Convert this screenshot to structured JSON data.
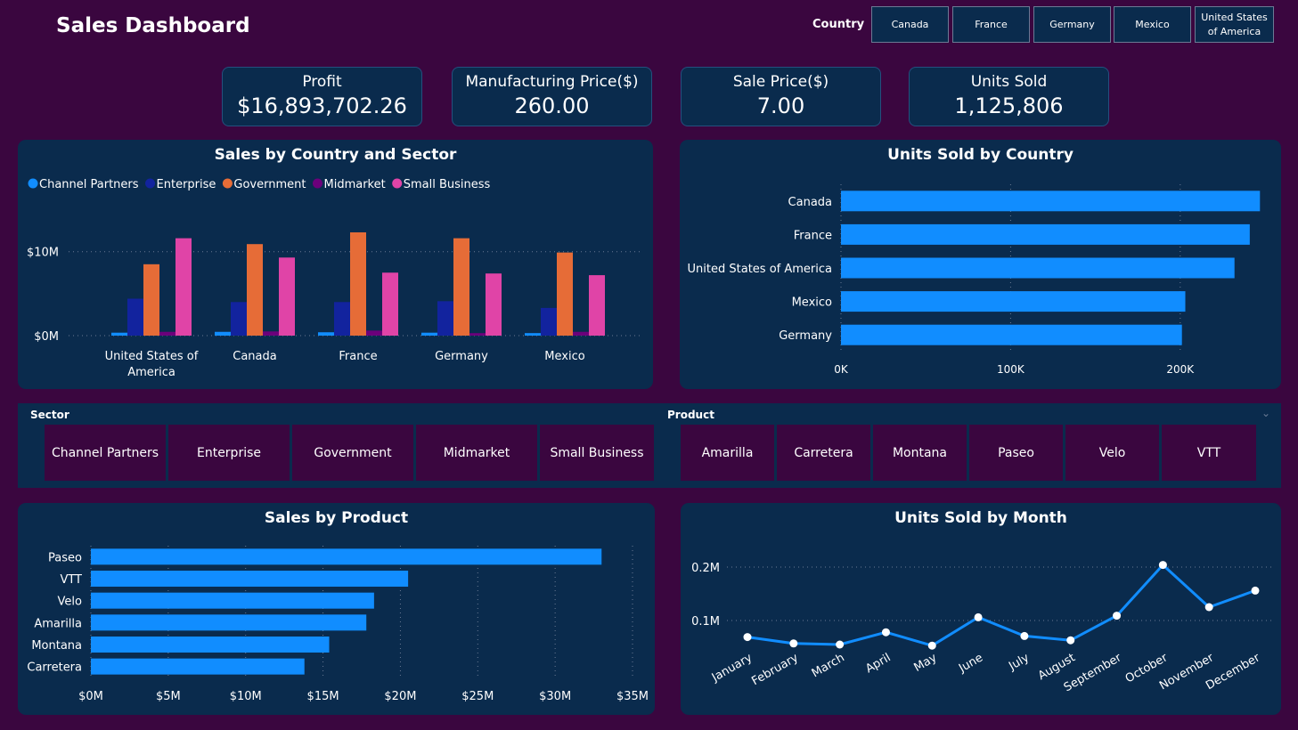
{
  "header": {
    "title": "Sales Dashboard"
  },
  "country_filter": {
    "label": "Country",
    "options": [
      "Canada",
      "France",
      "Germany",
      "Mexico",
      "United States of America"
    ]
  },
  "kpis": [
    {
      "label": "Profit",
      "value": "$16,893,702.26"
    },
    {
      "label": "Manufacturing Price($)",
      "value": "260.00"
    },
    {
      "label": "Sale Price($)",
      "value": "7.00"
    },
    {
      "label": "Units Sold",
      "value": "1,125,806"
    }
  ],
  "panels": {
    "sales_country_sector": "Sales by Country and Sector",
    "units_country": "Units Sold by Country",
    "sales_product": "Sales by Product",
    "units_month": "Units Sold by Month"
  },
  "slicers": {
    "sector": {
      "title": "Sector",
      "options": [
        "Channel Partners",
        "Enterprise",
        "Government",
        "Midmarket",
        "Small Business"
      ]
    },
    "product": {
      "title": "Product",
      "options": [
        "Amarilla",
        "Carretera",
        "Montana",
        "Paseo",
        "Velo",
        "VTT"
      ]
    }
  },
  "colors": {
    "channel_partners": "#118dff",
    "enterprise": "#12239e",
    "government": "#e66c37",
    "midmarket": "#6b007b",
    "small_business": "#e044a7",
    "bar": "#118dff",
    "line": "#118dff"
  },
  "chart_data": [
    {
      "type": "bar",
      "title": "Sales by Country and Sector",
      "categories": [
        "United States of America",
        "Canada",
        "France",
        "Germany",
        "Mexico"
      ],
      "series": [
        {
          "name": "Channel Partners",
          "values": [
            0.35,
            0.45,
            0.4,
            0.35,
            0.3
          ]
        },
        {
          "name": "Enterprise",
          "values": [
            4.4,
            4.0,
            4.0,
            4.1,
            3.3
          ]
        },
        {
          "name": "Government",
          "values": [
            8.5,
            10.9,
            12.3,
            11.6,
            9.9
          ]
        },
        {
          "name": "Midmarket",
          "values": [
            0.45,
            0.5,
            0.6,
            0.3,
            0.45
          ]
        },
        {
          "name": "Small Business",
          "values": [
            11.6,
            9.3,
            7.5,
            7.4,
            7.2
          ]
        }
      ],
      "ylim": [
        0,
        12.3
      ],
      "yticks": [
        0,
        10
      ],
      "ytick_labels": [
        "$0M",
        "$10M"
      ],
      "legend": "top-left",
      "grid": true
    },
    {
      "type": "bar",
      "orientation": "horizontal",
      "title": "Units Sold by Country",
      "categories": [
        "Canada",
        "France",
        "United States of America",
        "Mexico",
        "Germany"
      ],
      "values": [
        247000,
        241000,
        232000,
        203000,
        201000
      ],
      "xlim": [
        0,
        250000
      ],
      "xticks": [
        0,
        100000,
        200000
      ],
      "xtick_labels": [
        "0K",
        "100K",
        "200K"
      ],
      "grid": true
    },
    {
      "type": "bar",
      "orientation": "horizontal",
      "title": "Sales by Product",
      "categories": [
        "Paseo",
        "VTT",
        "Velo",
        "Amarilla",
        "Montana",
        "Carretera"
      ],
      "values": [
        33.0,
        20.5,
        18.3,
        17.8,
        15.4,
        13.8
      ],
      "xlim": [
        0,
        35
      ],
      "xticks": [
        0,
        5,
        10,
        15,
        20,
        25,
        30,
        35
      ],
      "xtick_labels": [
        "$0M",
        "$5M",
        "$10M",
        "$15M",
        "$20M",
        "$25M",
        "$30M",
        "$35M"
      ],
      "grid": true
    },
    {
      "type": "line",
      "title": "Units Sold by Month",
      "x": [
        "January",
        "February",
        "March",
        "April",
        "May",
        "June",
        "July",
        "August",
        "September",
        "October",
        "November",
        "December"
      ],
      "values": [
        0.069,
        0.057,
        0.055,
        0.078,
        0.053,
        0.106,
        0.071,
        0.063,
        0.109,
        0.204,
        0.125,
        0.156
      ],
      "ylim": [
        0,
        0.2
      ],
      "yticks": [
        0.1,
        0.2
      ],
      "ytick_labels": [
        "0.1M",
        "0.2M"
      ],
      "grid": true
    }
  ]
}
